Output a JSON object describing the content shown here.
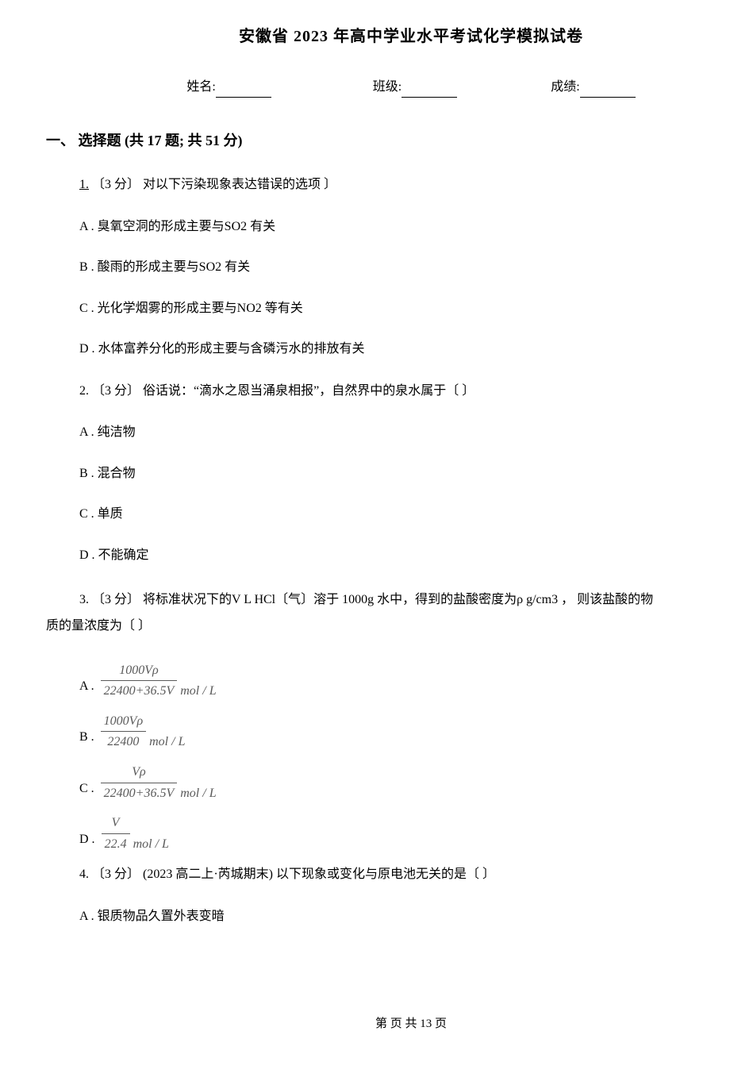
{
  "title": "安徽省 2023 年高中学业水平考试化学模拟试卷",
  "info": {
    "name_label": "姓名:",
    "class_label": "班级:",
    "score_label": "成绩:"
  },
  "section": {
    "header": "一、 选择题 (共 17 题; 共 51 分)"
  },
  "q1": {
    "num": "1.",
    "text": " 〔3 分〕 对以下污染现象表达错误的选项    〕",
    "A": "A . 臭氧空洞的形成主要与SO2 有关",
    "B": "B . 酸雨的形成主要与SO2 有关",
    "C": "C . 光化学烟雾的形成主要与NO2 等有关",
    "D": "D . 水体富养分化的形成主要与含磷污水的排放有关"
  },
  "q2": {
    "num": "2.",
    "text": " 〔3 分〕 俗话说：“滴水之恩当涌泉相报”，自然界中的泉水属于〔    〕",
    "A": "A . 纯洁物",
    "B": "B . 混合物",
    "C": "C . 单质",
    "D": "D . 不能确定"
  },
  "q3": {
    "num": "3.",
    "text_first": " 〔3 分〕 将标准状况下的V L HCl〔气〕溶于 1000g 水中，得到的盐酸密度为ρ g/cm3 ， 则该盐酸的物",
    "text_rest": "质的量浓度为〔    〕",
    "A_letter": "A .",
    "A_num": "1000Vρ",
    "A_den": "22400+36.5V",
    "A_unit": "mol / L",
    "B_letter": "B .",
    "B_num": "1000Vρ",
    "B_den": "22400",
    "B_unit": "mol / L",
    "C_letter": "C .",
    "C_num": "Vρ",
    "C_den": "22400+36.5V",
    "C_unit": "mol / L",
    "D_letter": "D .",
    "D_num": "V",
    "D_den": "22.4",
    "D_unit": "mol / L"
  },
  "q4": {
    "num": "4.",
    "text": " 〔3 分〕 (2023 高二上·芮城期末) 以下现象或变化与原电池无关的是〔    〕",
    "A": "A . 银质物品久置外表变暗"
  },
  "footer": "第  页 共 13 页"
}
